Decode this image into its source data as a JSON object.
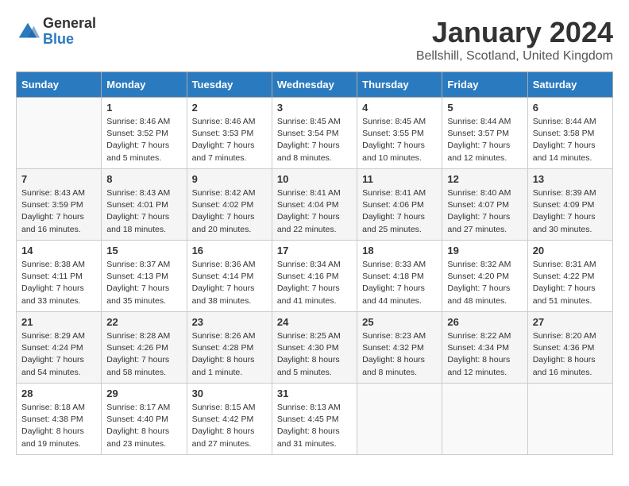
{
  "logo": {
    "general": "General",
    "blue": "Blue"
  },
  "title": "January 2024",
  "subtitle": "Bellshill, Scotland, United Kingdom",
  "headers": [
    "Sunday",
    "Monday",
    "Tuesday",
    "Wednesday",
    "Thursday",
    "Friday",
    "Saturday"
  ],
  "weeks": [
    [
      {
        "day": "",
        "sunrise": "",
        "sunset": "",
        "daylight": ""
      },
      {
        "day": "1",
        "sunrise": "Sunrise: 8:46 AM",
        "sunset": "Sunset: 3:52 PM",
        "daylight": "Daylight: 7 hours and 5 minutes."
      },
      {
        "day": "2",
        "sunrise": "Sunrise: 8:46 AM",
        "sunset": "Sunset: 3:53 PM",
        "daylight": "Daylight: 7 hours and 7 minutes."
      },
      {
        "day": "3",
        "sunrise": "Sunrise: 8:45 AM",
        "sunset": "Sunset: 3:54 PM",
        "daylight": "Daylight: 7 hours and 8 minutes."
      },
      {
        "day": "4",
        "sunrise": "Sunrise: 8:45 AM",
        "sunset": "Sunset: 3:55 PM",
        "daylight": "Daylight: 7 hours and 10 minutes."
      },
      {
        "day": "5",
        "sunrise": "Sunrise: 8:44 AM",
        "sunset": "Sunset: 3:57 PM",
        "daylight": "Daylight: 7 hours and 12 minutes."
      },
      {
        "day": "6",
        "sunrise": "Sunrise: 8:44 AM",
        "sunset": "Sunset: 3:58 PM",
        "daylight": "Daylight: 7 hours and 14 minutes."
      }
    ],
    [
      {
        "day": "7",
        "sunrise": "Sunrise: 8:43 AM",
        "sunset": "Sunset: 3:59 PM",
        "daylight": "Daylight: 7 hours and 16 minutes."
      },
      {
        "day": "8",
        "sunrise": "Sunrise: 8:43 AM",
        "sunset": "Sunset: 4:01 PM",
        "daylight": "Daylight: 7 hours and 18 minutes."
      },
      {
        "day": "9",
        "sunrise": "Sunrise: 8:42 AM",
        "sunset": "Sunset: 4:02 PM",
        "daylight": "Daylight: 7 hours and 20 minutes."
      },
      {
        "day": "10",
        "sunrise": "Sunrise: 8:41 AM",
        "sunset": "Sunset: 4:04 PM",
        "daylight": "Daylight: 7 hours and 22 minutes."
      },
      {
        "day": "11",
        "sunrise": "Sunrise: 8:41 AM",
        "sunset": "Sunset: 4:06 PM",
        "daylight": "Daylight: 7 hours and 25 minutes."
      },
      {
        "day": "12",
        "sunrise": "Sunrise: 8:40 AM",
        "sunset": "Sunset: 4:07 PM",
        "daylight": "Daylight: 7 hours and 27 minutes."
      },
      {
        "day": "13",
        "sunrise": "Sunrise: 8:39 AM",
        "sunset": "Sunset: 4:09 PM",
        "daylight": "Daylight: 7 hours and 30 minutes."
      }
    ],
    [
      {
        "day": "14",
        "sunrise": "Sunrise: 8:38 AM",
        "sunset": "Sunset: 4:11 PM",
        "daylight": "Daylight: 7 hours and 33 minutes."
      },
      {
        "day": "15",
        "sunrise": "Sunrise: 8:37 AM",
        "sunset": "Sunset: 4:13 PM",
        "daylight": "Daylight: 7 hours and 35 minutes."
      },
      {
        "day": "16",
        "sunrise": "Sunrise: 8:36 AM",
        "sunset": "Sunset: 4:14 PM",
        "daylight": "Daylight: 7 hours and 38 minutes."
      },
      {
        "day": "17",
        "sunrise": "Sunrise: 8:34 AM",
        "sunset": "Sunset: 4:16 PM",
        "daylight": "Daylight: 7 hours and 41 minutes."
      },
      {
        "day": "18",
        "sunrise": "Sunrise: 8:33 AM",
        "sunset": "Sunset: 4:18 PM",
        "daylight": "Daylight: 7 hours and 44 minutes."
      },
      {
        "day": "19",
        "sunrise": "Sunrise: 8:32 AM",
        "sunset": "Sunset: 4:20 PM",
        "daylight": "Daylight: 7 hours and 48 minutes."
      },
      {
        "day": "20",
        "sunrise": "Sunrise: 8:31 AM",
        "sunset": "Sunset: 4:22 PM",
        "daylight": "Daylight: 7 hours and 51 minutes."
      }
    ],
    [
      {
        "day": "21",
        "sunrise": "Sunrise: 8:29 AM",
        "sunset": "Sunset: 4:24 PM",
        "daylight": "Daylight: 7 hours and 54 minutes."
      },
      {
        "day": "22",
        "sunrise": "Sunrise: 8:28 AM",
        "sunset": "Sunset: 4:26 PM",
        "daylight": "Daylight: 7 hours and 58 minutes."
      },
      {
        "day": "23",
        "sunrise": "Sunrise: 8:26 AM",
        "sunset": "Sunset: 4:28 PM",
        "daylight": "Daylight: 8 hours and 1 minute."
      },
      {
        "day": "24",
        "sunrise": "Sunrise: 8:25 AM",
        "sunset": "Sunset: 4:30 PM",
        "daylight": "Daylight: 8 hours and 5 minutes."
      },
      {
        "day": "25",
        "sunrise": "Sunrise: 8:23 AM",
        "sunset": "Sunset: 4:32 PM",
        "daylight": "Daylight: 8 hours and 8 minutes."
      },
      {
        "day": "26",
        "sunrise": "Sunrise: 8:22 AM",
        "sunset": "Sunset: 4:34 PM",
        "daylight": "Daylight: 8 hours and 12 minutes."
      },
      {
        "day": "27",
        "sunrise": "Sunrise: 8:20 AM",
        "sunset": "Sunset: 4:36 PM",
        "daylight": "Daylight: 8 hours and 16 minutes."
      }
    ],
    [
      {
        "day": "28",
        "sunrise": "Sunrise: 8:18 AM",
        "sunset": "Sunset: 4:38 PM",
        "daylight": "Daylight: 8 hours and 19 minutes."
      },
      {
        "day": "29",
        "sunrise": "Sunrise: 8:17 AM",
        "sunset": "Sunset: 4:40 PM",
        "daylight": "Daylight: 8 hours and 23 minutes."
      },
      {
        "day": "30",
        "sunrise": "Sunrise: 8:15 AM",
        "sunset": "Sunset: 4:42 PM",
        "daylight": "Daylight: 8 hours and 27 minutes."
      },
      {
        "day": "31",
        "sunrise": "Sunrise: 8:13 AM",
        "sunset": "Sunset: 4:45 PM",
        "daylight": "Daylight: 8 hours and 31 minutes."
      },
      {
        "day": "",
        "sunrise": "",
        "sunset": "",
        "daylight": ""
      },
      {
        "day": "",
        "sunrise": "",
        "sunset": "",
        "daylight": ""
      },
      {
        "day": "",
        "sunrise": "",
        "sunset": "",
        "daylight": ""
      }
    ]
  ]
}
